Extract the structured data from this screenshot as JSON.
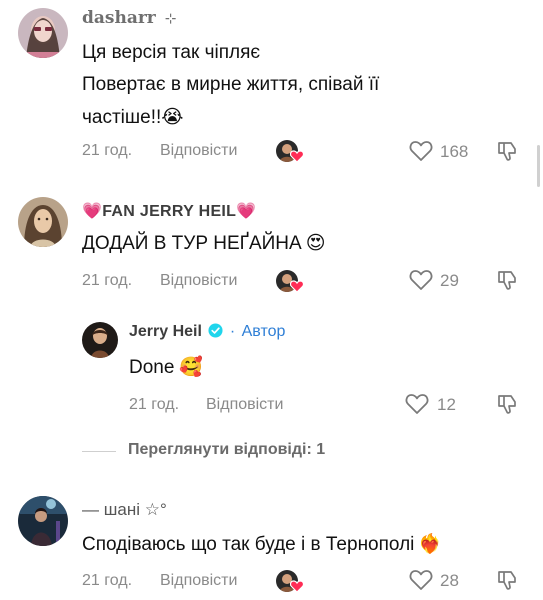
{
  "comments": [
    {
      "username": "dasharr",
      "username_suffix": "⊹",
      "lines": [
        "Ця версія так чіпляє",
        "Повертає в мирне життя, співай її",
        "частіше!!"
      ],
      "line3_emoji": "😭",
      "time": "21 год.",
      "reply_label": "Відповісти",
      "likes": "168"
    },
    {
      "username_prefix_emoji": "💗",
      "username": "FAN JERRY HEIL",
      "username_suffix_emoji": "💗",
      "text": "ДОДАЙ В ТУР НЕҐАЙНА",
      "text_emoji": "😍",
      "time": "21 год.",
      "reply_label": "Відповісти",
      "likes": "29"
    },
    {
      "username": "— шані",
      "username_suffix": "☆°",
      "text": "Сподіваюсь що так буде і в Тернополі",
      "text_emoji": "❤️‍🔥",
      "time": "21 год.",
      "reply_label": "Відповісти",
      "likes": "28"
    }
  ],
  "reply": {
    "username": "Jerry Heil",
    "separator": "·",
    "author_label": "Автор",
    "text": "Done",
    "text_emoji": "🥰",
    "time": "21 год.",
    "reply_label": "Відповісти",
    "likes": "12"
  },
  "view_replies": "Переглянути відповіді: 1",
  "colors": {
    "heart_badge": "#ff2d55",
    "verified": "#20d5ec",
    "author": "#2f7fd6",
    "meta": "#8a8a8a"
  },
  "icons": {
    "like": "heart-outline-icon",
    "dislike": "thumbs-down-outline-icon",
    "creator_liked": "creator-liked-heart-icon",
    "verified": "verified-badge-icon"
  }
}
